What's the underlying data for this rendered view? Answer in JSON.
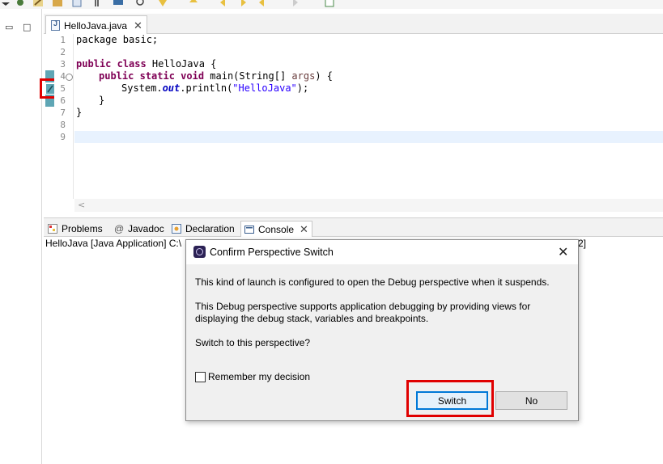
{
  "editor": {
    "tab_label": "HelloJava.java",
    "tab_icon": "java-file-icon",
    "line_numbers": [
      "1",
      "2",
      "3",
      "4",
      "5",
      "6",
      "7",
      "8",
      "9"
    ],
    "code": {
      "line1": "package basic;",
      "line3_kw": "public class",
      "line3_rest": " HelloJava {",
      "line4_kw": "public static void",
      "line4_mid": " main(String[] ",
      "line4_param": "args",
      "line4_end": ") {",
      "line5_a": "System.",
      "line5_field": "out",
      "line5_b": ".println(",
      "line5_str": "\"HelloJava\"",
      "line5_c": ");",
      "line6": "}",
      "line7": "}"
    },
    "fold_symbol": "⊖",
    "scroll_left": "<"
  },
  "left_strip": {
    "minimize": "▭",
    "maximize": "□"
  },
  "panel": {
    "tabs": [
      {
        "label": "Problems",
        "icon": "problems-icon"
      },
      {
        "label": "Javadoc",
        "icon": "javadoc-icon"
      },
      {
        "label": "Declaration",
        "icon": "declaration-icon"
      },
      {
        "label": "Console",
        "icon": "console-icon"
      }
    ],
    "console_status": "HelloJava [Java Application] C:\\",
    "console_status_tail": "2]"
  },
  "dialog": {
    "title": "Confirm Perspective Switch",
    "message1": "This kind of launch is configured to open the Debug perspective when it suspends.",
    "message2_line1": "This Debug perspective supports application debugging by providing views for",
    "message2_line2": "displaying the debug stack, variables and breakpoints.",
    "question": "Switch to this perspective?",
    "remember_label": "Remember my decision",
    "remember_checked": false,
    "switch_label": "Switch",
    "no_label": "No",
    "close_symbol": "✕"
  },
  "colors": {
    "highlight_box": "#e00000",
    "keyword": "#7f0055",
    "string": "#2a00ff",
    "debug_marker": "#5fa6b5",
    "default_button_border": "#0078d7"
  }
}
